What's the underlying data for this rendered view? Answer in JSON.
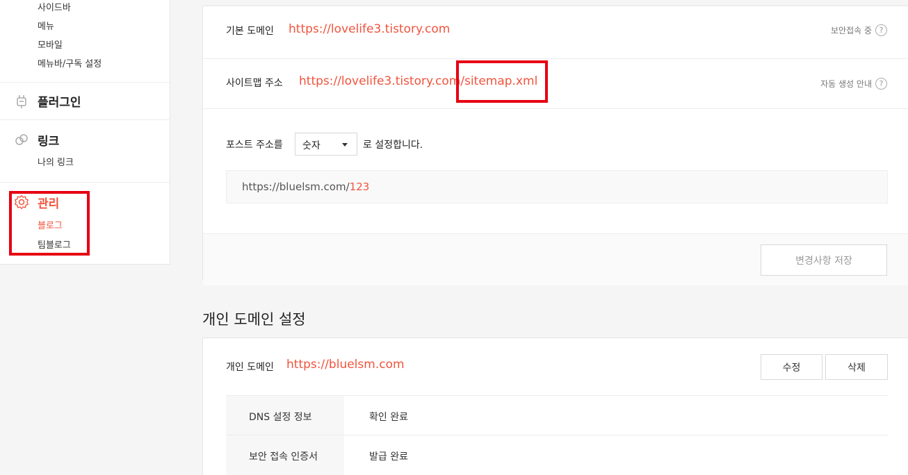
{
  "sidebar": {
    "sub_items_top": [
      "사이드바",
      "메뉴",
      "모바일",
      "메뉴바/구독 설정"
    ],
    "plugin_title": "플러그인",
    "link_title": "링크",
    "link_items": [
      "나의 링크"
    ],
    "manage_title": "관리",
    "manage_items": [
      "블로그",
      "팀블로그"
    ],
    "accent_color": "#f0533c"
  },
  "domain_panel": {
    "default_domain_label": "기본 도메인",
    "default_domain_url": "https://lovelife3.tistory.com",
    "default_domain_help": "보안접속 중",
    "sitemap_label": "사이트맵 주소",
    "sitemap_url_base": "https://lovelife3.tistory.com/",
    "sitemap_url_file": "sitemap.xml",
    "sitemap_help": "자동 생성 안내",
    "post_address_prefix": "포스트 주소를",
    "post_address_select": "숫자",
    "post_address_suffix": "로 설정합니다.",
    "preview_base": "https://bluelsm.com/",
    "preview_num": "123",
    "save_button": "변경사항 저장"
  },
  "personal_domain": {
    "heading": "개인 도메인 설정",
    "label": "개인 도메인",
    "url": "https://bluelsm.com",
    "edit_button": "수정",
    "delete_button": "삭제",
    "rows": [
      {
        "key": "DNS 설정 정보",
        "value": "확인 완료"
      },
      {
        "key": "보안 접속 인증서",
        "value": "발급 완료"
      }
    ]
  },
  "help_glyph": "?"
}
